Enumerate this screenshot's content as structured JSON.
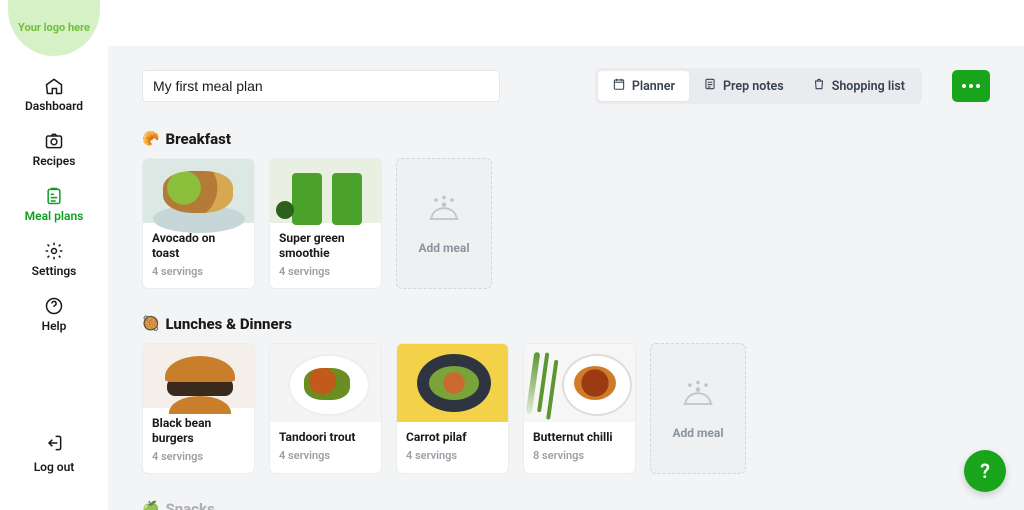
{
  "logo_text": "Your logo here",
  "sidebar": {
    "items": [
      {
        "label": "Dashboard"
      },
      {
        "label": "Recipes"
      },
      {
        "label": "Meal plans"
      },
      {
        "label": "Settings"
      },
      {
        "label": "Help"
      }
    ],
    "logout_label": "Log out"
  },
  "header": {
    "plan_title_value": "My first meal plan",
    "tabs": [
      {
        "label": "Planner"
      },
      {
        "label": "Prep notes"
      },
      {
        "label": "Shopping list"
      }
    ]
  },
  "sections": {
    "breakfast": {
      "emoji": "🥐",
      "title": "Breakfast",
      "add_label": "Add meal",
      "meals": [
        {
          "title": "Avocado on toast",
          "servings": "4 servings"
        },
        {
          "title": "Super green smoothie",
          "servings": "4 servings"
        }
      ]
    },
    "lunches": {
      "emoji": "🥘",
      "title": "Lunches & Dinners",
      "add_label": "Add meal",
      "meals": [
        {
          "title": "Black bean burgers",
          "servings": "4 servings"
        },
        {
          "title": "Tandoori trout",
          "servings": "4 servings"
        },
        {
          "title": "Carrot pilaf",
          "servings": "4 servings"
        },
        {
          "title": "Butternut chilli",
          "servings": "8 servings"
        }
      ]
    },
    "snacks": {
      "emoji": "🍏",
      "title": "Snacks"
    }
  },
  "help_fab": "?"
}
